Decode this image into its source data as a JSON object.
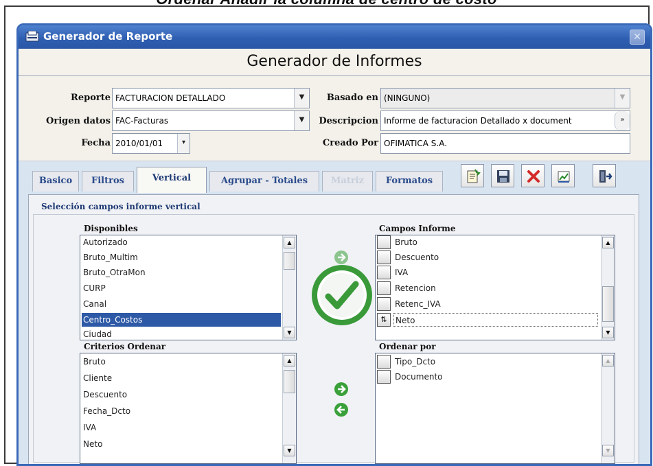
{
  "caption": "Ordenar Añadir la columna de centro de costo",
  "window": {
    "title": "Generador de Reporte",
    "close_glyph": "✕"
  },
  "heading": "Generador de Informes",
  "form": {
    "reporte_label": "Reporte",
    "reporte_value": "FACTURACION DETALLADO",
    "origen_label": "Origen datos",
    "origen_value": "FAC-Facturas",
    "fecha_label": "Fecha",
    "fecha_value": "2010/01/01",
    "basado_label": "Basado en",
    "basado_value": "(NINGUNO)",
    "descripcion_label": "Descripcion",
    "descripcion_value": "Informe de facturacion Detallado x document",
    "creado_label": "Creado Por",
    "creado_value": "OFIMATICA S.A."
  },
  "tabs": [
    {
      "label": "Basico"
    },
    {
      "label": "Filtros"
    },
    {
      "label": "Vertical"
    },
    {
      "label": "Agrupar - Totales"
    },
    {
      "label": "Matriz"
    },
    {
      "label": "Formatos"
    }
  ],
  "panel": {
    "title": "Selección campos informe vertical",
    "disponibles_label": "Disponibles",
    "disponibles": [
      "Autorizado",
      "Bruto_Multim",
      "Bruto_OtraMon",
      "CURP",
      "Canal",
      "Centro_Costos",
      "Ciudad"
    ],
    "selected_item": "Centro_Costos",
    "campos_label": "Campos Informe",
    "campos": [
      "Bruto",
      "Descuento",
      "IVA",
      "Retencion",
      "Retenc_IVA",
      "Neto"
    ],
    "criterios_label": "Criterios Ordenar",
    "criterios": [
      "Bruto",
      "Cliente",
      "Descuento",
      "Fecha_Dcto",
      "IVA",
      "Neto"
    ],
    "ordenar_label": "Ordenar por",
    "ordenar": [
      "Tipo_Dcto",
      "Documento"
    ]
  },
  "colors": {
    "selection": "#2d59a6",
    "titlebar": "#2f5fb2",
    "check_ring": "#3a9a3a"
  }
}
